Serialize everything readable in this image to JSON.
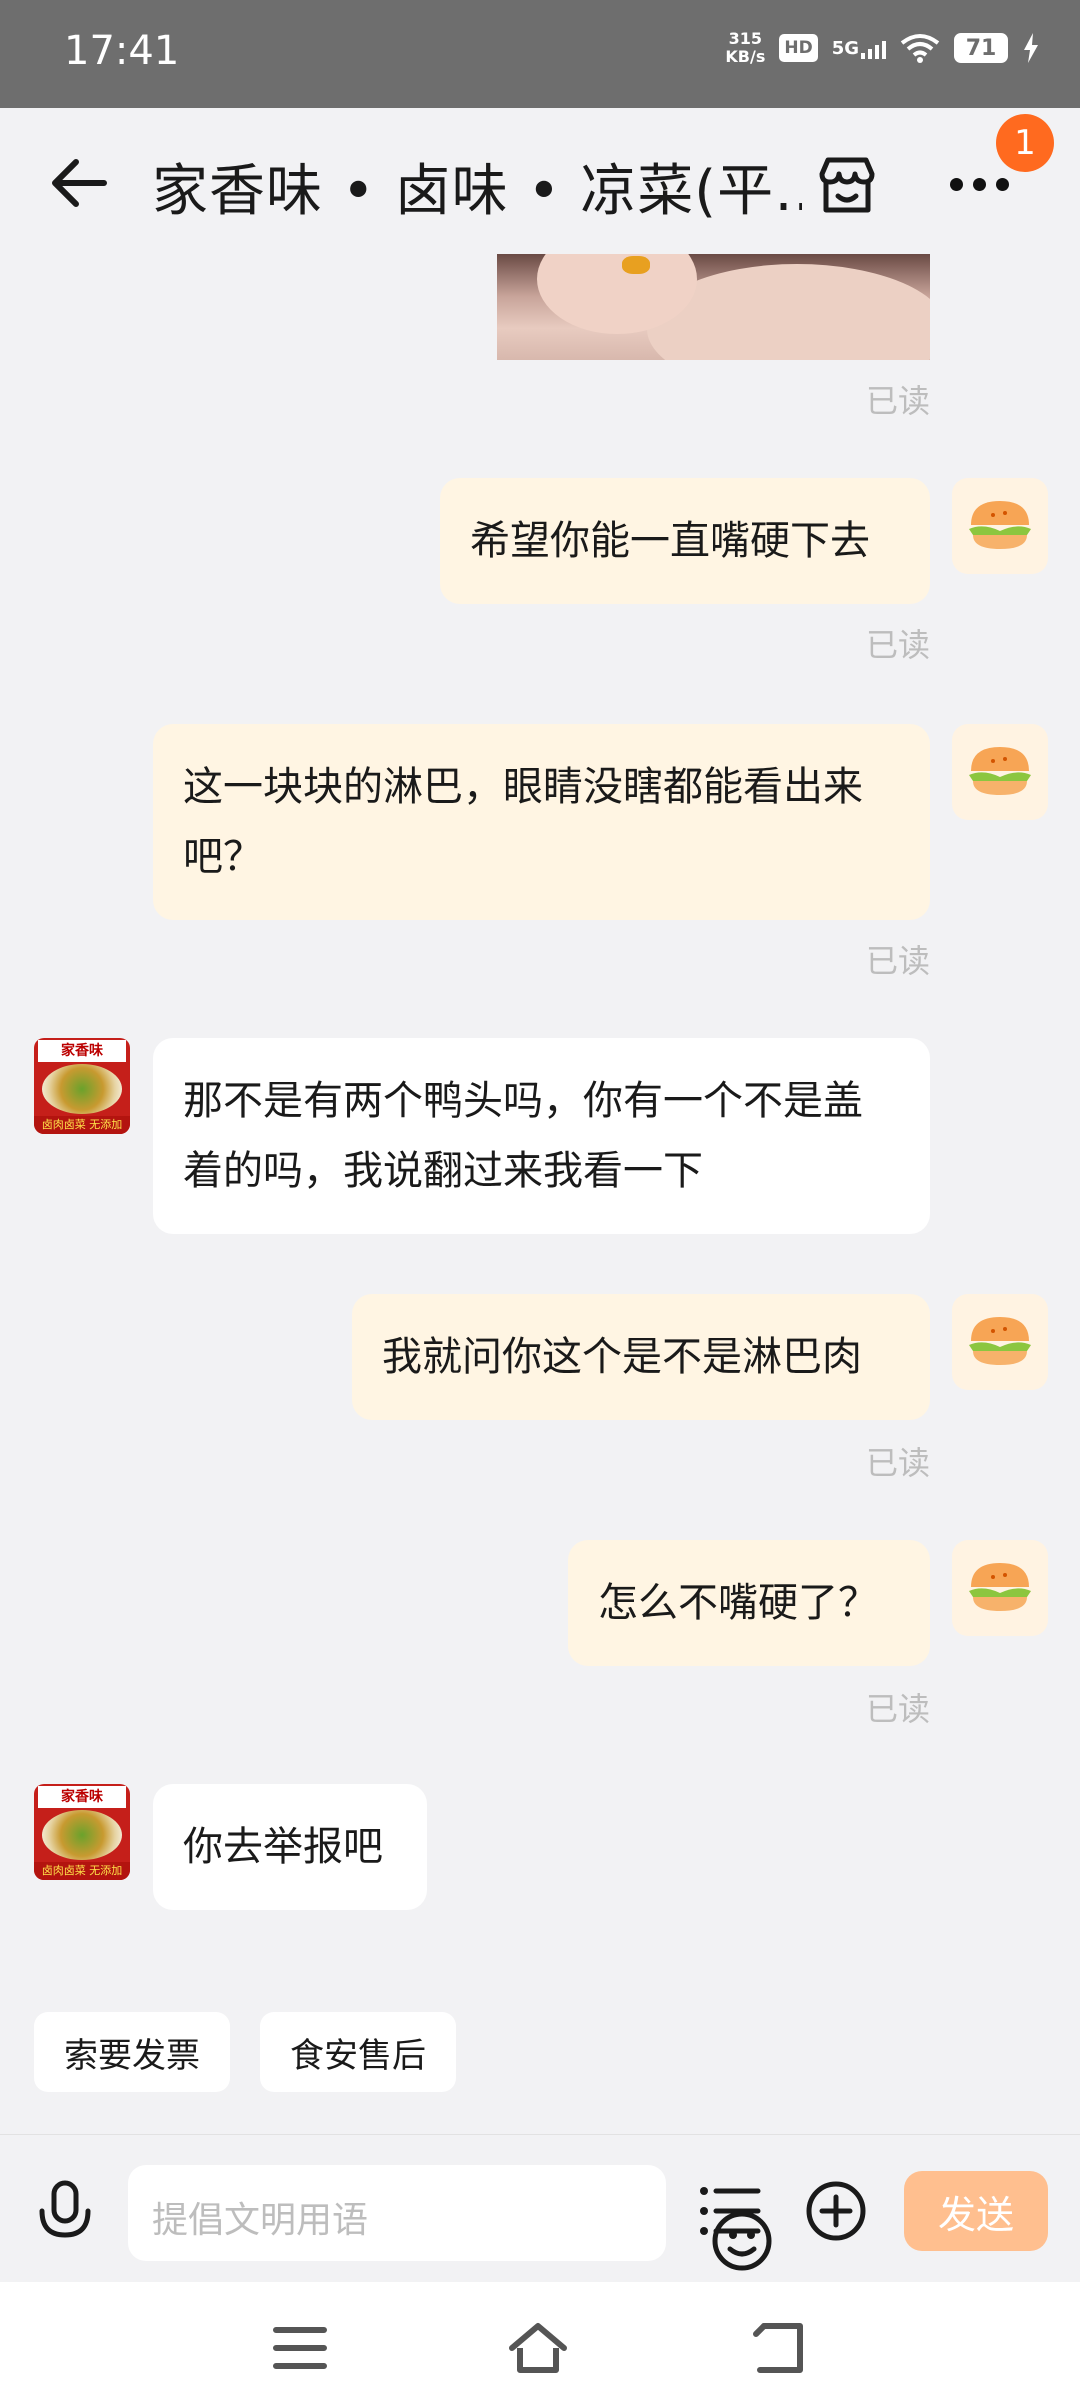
{
  "status_bar": {
    "time": "17:41",
    "net_speed_value": "315",
    "net_speed_unit": "KB/s",
    "hd": "HD",
    "network": "5G",
    "battery": "71"
  },
  "header": {
    "title": "家香味 • 卤味 • 凉菜(平…",
    "notification_count": "1"
  },
  "messages": [
    {
      "side": "me",
      "text": "希望你能一直嘴硬下去",
      "status": "已读"
    },
    {
      "side": "me",
      "text": "这一块块的淋巴，眼睛没瞎都能看出来吧？",
      "status": "已读"
    },
    {
      "side": "them",
      "text": "那不是有两个鸭头吗，你有一个不是盖着的吗，我说翻过来我看一下"
    },
    {
      "side": "me",
      "text": "我就问你这个是不是淋巴肉",
      "status": "已读"
    },
    {
      "side": "me",
      "text": "怎么不嘴硬了？",
      "status": "已读"
    },
    {
      "side": "them",
      "text": "你去举报吧"
    }
  ],
  "image_status": "已读",
  "shop_avatar": {
    "top": "家香味",
    "bottom": "卤肉卤菜 无添加"
  },
  "quick_actions": [
    "索要发票",
    "食安售后"
  ],
  "input": {
    "placeholder": "提倡文明用语",
    "send_label": "发送"
  },
  "colors": {
    "accent": "#ff6a1f",
    "my_bubble": "#fff5e3",
    "send_button": "#ffbf8f"
  }
}
